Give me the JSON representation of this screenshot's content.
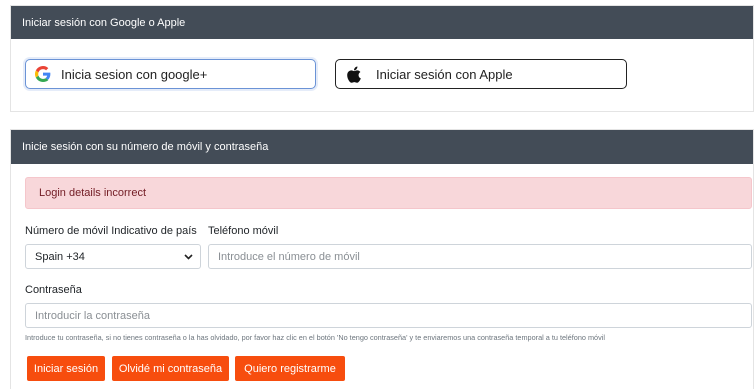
{
  "social_card": {
    "header": "Iniciar sesión con Google o Apple",
    "google_label": "Inicia sesion con google+",
    "apple_label": "Iniciar sesión con Apple"
  },
  "mobile_card": {
    "header": "Inicie sesión con su número de móvil y contraseña",
    "alert": "Login details incorrect",
    "country_label": "Número de móvil Indicativo de país",
    "country_value": "Spain +34",
    "phone_label": "Teléfono móvil",
    "phone_placeholder": "Introduce el número de móvil",
    "password_label": "Contraseña",
    "password_placeholder": "Introducir la contraseña",
    "help_text": "Introduce tu contraseña, si no tienes contraseña o la has olvidado, por favor haz clic en el botón 'No tengo contraseña' y te enviaremos una contraseña temporal a tu teléfono móvil",
    "buttons": {
      "login": "Iniciar sesión",
      "forgot": "Olvidé mi contraseña",
      "register": "Quiero registrarme"
    }
  },
  "colors": {
    "header_bg": "#434c57",
    "accent_orange": "#f74d0e",
    "alert_bg": "#f8d7da",
    "alert_text": "#721c24"
  },
  "icons": {
    "google": "google-g-logo",
    "apple": "apple-logo",
    "select_arrow": "chevron-down"
  }
}
